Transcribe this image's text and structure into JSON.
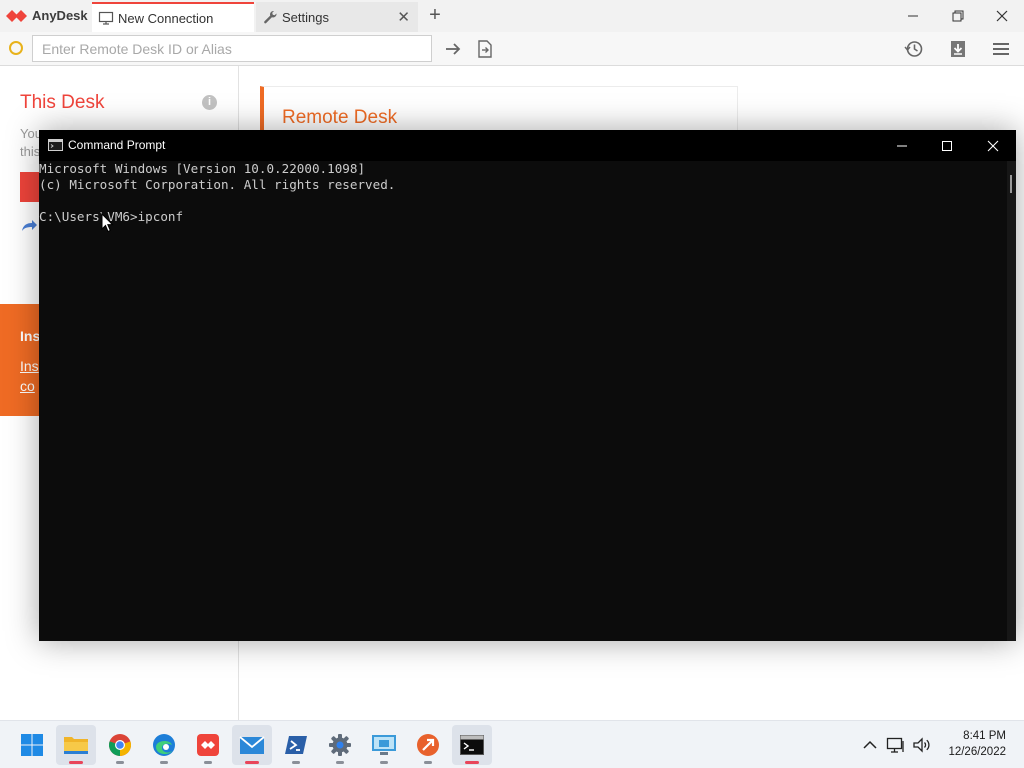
{
  "anydesk": {
    "app_name": "AnyDesk",
    "tabs": [
      {
        "label": "New Connection",
        "icon": "monitor-icon"
      },
      {
        "label": "Settings",
        "icon": "wrench-icon"
      }
    ],
    "remote_id_placeholder": "Enter Remote Desk ID or Alias",
    "sidebar": {
      "this_desk_title": "This Desk",
      "desc_line1": "You",
      "desc_line2": "this",
      "install_banner": {
        "title": "Ins",
        "link_line1": "Ins",
        "link_line2": "co"
      }
    },
    "remote_desk_title": "Remote Desk",
    "colors": {
      "brand": "#ef443b",
      "accent": "#ef6b24",
      "status": "#e8b21b"
    }
  },
  "cmd": {
    "title": "Command Prompt",
    "lines": [
      "Microsoft Windows [Version 10.0.22000.1098]",
      "(c) Microsoft Corporation. All rights reserved.",
      "",
      "C:\\Users\\VM6>ipconf"
    ]
  },
  "taskbar": {
    "apps": [
      {
        "name": "windows-start-icon"
      },
      {
        "name": "file-explorer-icon"
      },
      {
        "name": "chrome-icon"
      },
      {
        "name": "edge-icon"
      },
      {
        "name": "anydesk-icon"
      },
      {
        "name": "mail-icon"
      },
      {
        "name": "powershell-icon"
      },
      {
        "name": "settings-gear-icon"
      },
      {
        "name": "remote-desktop-icon"
      },
      {
        "name": "remote-app-icon"
      },
      {
        "name": "terminal-icon"
      }
    ],
    "clock": {
      "time": "8:41 PM",
      "date": "12/26/2022"
    }
  }
}
